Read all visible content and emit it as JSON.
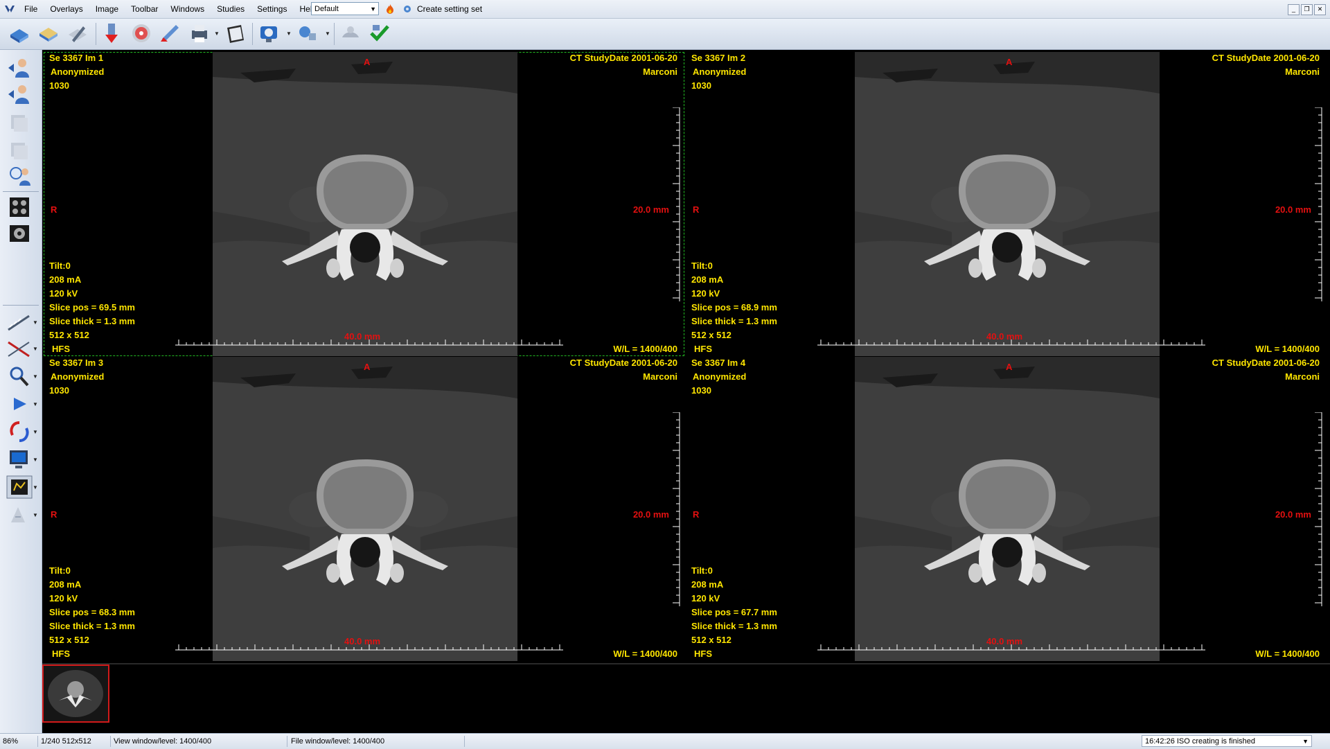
{
  "menu": {
    "items": [
      "File",
      "Overlays",
      "Image",
      "Toolbar",
      "Windows",
      "Studies",
      "Settings",
      "Help"
    ],
    "preset_value": "Default",
    "create_setting_label": "Create setting set"
  },
  "viewports": [
    {
      "series": "Se 3367 Im 1",
      "patient": "Anonymized",
      "number": "1030",
      "modality_date": "CT StudyDate 2001-06-20",
      "institution": "Marconi",
      "orient_top": "A",
      "orient_left": "R",
      "scale_v": "20.0 mm",
      "scale_h": "40.0 mm",
      "tilt": "Tilt:0",
      "ma": "208 mA",
      "kv": "120 kV",
      "slice_pos": "Slice pos = 69.5 mm",
      "slice_thick": "Slice thick = 1.3 mm",
      "matrix": "512 x 512",
      "position": "HFS",
      "wl": "W/L = 1400/400",
      "active": true
    },
    {
      "series": "Se 3367 Im 2",
      "patient": "Anonymized",
      "number": "1030",
      "modality_date": "CT StudyDate 2001-06-20",
      "institution": "Marconi",
      "orient_top": "A",
      "orient_left": "R",
      "scale_v": "20.0 mm",
      "scale_h": "40.0 mm",
      "tilt": "Tilt:0",
      "ma": "208 mA",
      "kv": "120 kV",
      "slice_pos": "Slice pos = 68.9 mm",
      "slice_thick": "Slice thick = 1.3 mm",
      "matrix": "512 x 512",
      "position": "HFS",
      "wl": "W/L = 1400/400",
      "active": false
    },
    {
      "series": "Se 3367 Im 3",
      "patient": "Anonymized",
      "number": "1030",
      "modality_date": "CT StudyDate 2001-06-20",
      "institution": "Marconi",
      "orient_top": "A",
      "orient_left": "R",
      "scale_v": "20.0 mm",
      "scale_h": "40.0 mm",
      "tilt": "Tilt:0",
      "ma": "208 mA",
      "kv": "120 kV",
      "slice_pos": "Slice pos = 68.3 mm",
      "slice_thick": "Slice thick = 1.3 mm",
      "matrix": "512 x 512",
      "position": "HFS",
      "wl": "W/L = 1400/400",
      "active": false
    },
    {
      "series": "Se 3367 Im 4",
      "patient": "Anonymized",
      "number": "1030",
      "modality_date": "CT StudyDate 2001-06-20",
      "institution": "Marconi",
      "orient_top": "A",
      "orient_left": "R",
      "scale_v": "20.0 mm",
      "scale_h": "40.0 mm",
      "tilt": "Tilt:0",
      "ma": "208 mA",
      "kv": "120 kV",
      "slice_pos": "Slice pos = 67.7 mm",
      "slice_thick": "Slice thick = 1.3 mm",
      "matrix": "512 x 512",
      "position": "HFS",
      "wl": "W/L = 1400/400",
      "active": false
    }
  ],
  "status": {
    "zoom": "86%",
    "image_info": "1/240 512x512",
    "view_wl": "View window/level: 1400/400",
    "file_wl": "File window/level: 1400/400",
    "message": "16:42:26 ISO creating is finished"
  },
  "colors": {
    "overlay_text": "#ffe600",
    "overlay_red": "#e41010",
    "active_border": "#22bb22",
    "thumb_border": "#d21a1a"
  }
}
